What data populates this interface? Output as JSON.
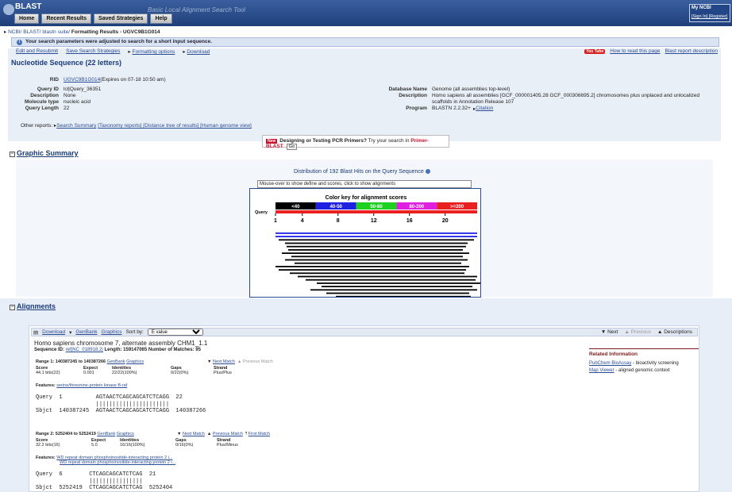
{
  "header": {
    "brand": "BLAST",
    "tagline": "Basic Local Alignment Search Tool",
    "nav": [
      "Home",
      "Recent Results",
      "Saved Strategies",
      "Help"
    ],
    "my_ncbi": "My NCBI",
    "sign_in": "[Sign In] [Register]"
  },
  "breadcrumb": {
    "part1": "NCBI/ BLAST/ blastn suite/",
    "part2": " Formatting Results - UGVC9B1G014"
  },
  "notice": "Your search parameters were adjusted to search for a short input sequence.",
  "actions": [
    "Edit and Resubmit",
    "Save Search Strategies",
    "Formatting options",
    "Download"
  ],
  "right_links": {
    "youtube": "You Tube",
    "how_to": "How to read this page",
    "report_desc": "Blast report description"
  },
  "title": "Nucleotide Sequence (22 letters)",
  "info_left": [
    {
      "k": "RID",
      "v_link": "UGVC9B1G014",
      "v": " (Expires on 07-18 10:50 am)"
    },
    {
      "k": "Query ID",
      "v": "lcl|Query_36351"
    },
    {
      "k": "Description",
      "v": "None"
    },
    {
      "k": "Molecule type",
      "v": "nucleic acid"
    },
    {
      "k": "Query Length",
      "v": "22"
    }
  ],
  "info_right": {
    "db_k": "Database Name",
    "db_v": "Genome (all assemblies top-level)",
    "desc_k": "Description",
    "desc_v1": "Homo sapiens all assemblies [GCF_000001405.28 GCF_000306695.2] chromosomes plus unplaced and unlocalized",
    "desc_v2": "scaffolds in Annotation Release 107",
    "prog_k": "Program",
    "prog_v": "BLASTN 2.2.32+",
    "citation": "Citation"
  },
  "other_reports": {
    "label": "Other reports:",
    "search_summary": "Search Summary",
    "links": "[Taxonomy reports] [Distance tree of results] [Human genome view]"
  },
  "primer": {
    "new": "New",
    "text": "Designing or Testing PCR Primers?",
    "tail": " Try your search in ",
    "red": "Primer-BLAST",
    "go": "Go"
  },
  "graphic_summary": {
    "heading": "Graphic Summary",
    "title": "Distribution of 192 Blast Hits on the Query Sequence",
    "hint": "Mouse-over to show define and scores, click to show alignments",
    "key_title": "Color key for alignment scores",
    "key": [
      {
        "label": "<40",
        "color": "#000000"
      },
      {
        "label": "40-50",
        "color": "#2020e0"
      },
      {
        "label": "50-80",
        "color": "#20d020"
      },
      {
        "label": "80-200",
        "color": "#e020e0"
      },
      {
        "label": ">=200",
        "color": "#e82020"
      }
    ],
    "query_label": "Query",
    "ticks": [
      "1",
      "4",
      "8",
      "12",
      "16",
      "20"
    ]
  },
  "alignments": {
    "heading": "Alignments",
    "download": "Download",
    "genbank": "GenBank",
    "graphics": "Graphics",
    "sort_label": "Sort by:",
    "sort_value": "E value",
    "next": "Next",
    "previous": "Previous",
    "descriptions": "Descriptions",
    "hit_title": "Homo sapiens chromosome 7, alternate assembly CHM1_1.1",
    "seq_id_label": "Sequence ID:",
    "seq_id": "ref|NC_018918.2|",
    "length": "Length: 159147065",
    "matches": "Number of Matches: 95",
    "related_title": "Related Information",
    "related": [
      {
        "link": "PubChem BioAssay",
        "text": " - bioactivity screening"
      },
      {
        "link": "Map Viewer",
        "text": " - aligned genomic context"
      }
    ],
    "range1": {
      "label": "Range 1: 140387245 to 140387266",
      "genbank": "GenBank",
      "graphics": "Graphics",
      "next_match": "Next Match",
      "prev_match": "Previous Match",
      "headers": [
        "Score",
        "Expect",
        "Identities",
        "Gaps",
        "Strand"
      ],
      "values": [
        "44.1 bits(22)",
        "0.001",
        "22/22(100%)",
        "0/22(0%)",
        "Plus/Plus"
      ],
      "features_label": "Features:",
      "feature": "serine/threonine-protein kinase B-raf",
      "query_line": "Query  1          AGTAACTCAGCAGCATCTCAGG  22",
      "bars_line": "                  ||||||||||||||||||||||",
      "sbjct_line": "Sbjct  140387245  AGTAACTCAGCAGCATCTCAGG  140387266"
    },
    "range2": {
      "label": "Range 2: 5252404 to 5252419",
      "genbank": "GenBank",
      "graphics": "Graphics",
      "next_match": "Next Match",
      "prev_match": "Previous Match",
      "first_match": "First Match",
      "headers": [
        "Score",
        "Expect",
        "Identities",
        "Gaps",
        "Strand"
      ],
      "values": [
        "32.2 bits(16)",
        "5.0",
        "16/16(100%)",
        "0/16(0%)",
        "Plus/Minus"
      ],
      "features_label": "Features:",
      "feature1": "WD repeat domain phosphoinositide-interacting protein 2 i...",
      "feature2": "WD repeat domain phosphoinositide-interacting protein 2 i...",
      "query_line": "Query  6        CTCAGCAGCATCTCAG  21",
      "bars_line": "                ||||||||||||||||",
      "sbjct_line": "Sbjct  5252419  CTCAGCAGCATCTCAG  5252404"
    }
  }
}
